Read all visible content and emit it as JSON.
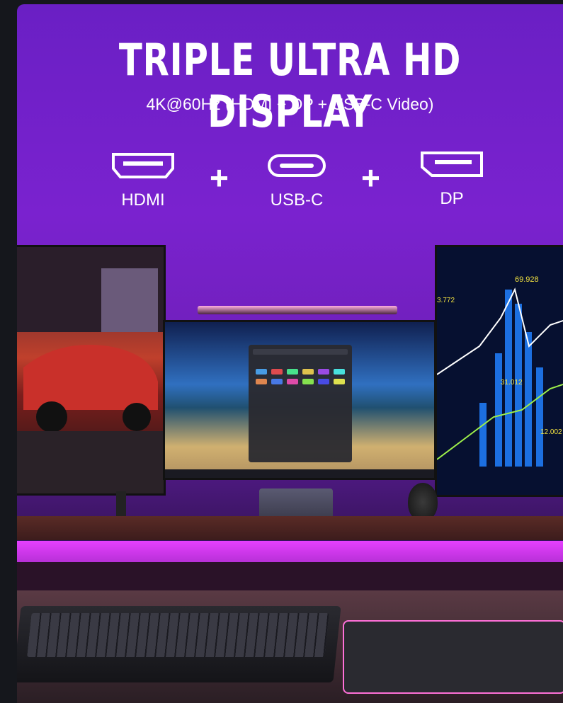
{
  "headline": {
    "title": "TRIPLE ULTRA HD DISPLAY",
    "subtitle": "4K@60Hz (HDMI + DP + USB-C Video)"
  },
  "ports": [
    {
      "label": "HDMI",
      "icon": "hdmi-port-icon"
    },
    {
      "label": "USB-C",
      "icon": "usb-c-port-icon"
    },
    {
      "label": "DP",
      "icon": "displayport-icon"
    }
  ],
  "separators": [
    "+",
    "+"
  ],
  "chart_readouts": {
    "peak": "69.928",
    "mid": "31.012",
    "low": "12.002",
    "left": "3.772"
  },
  "colors": {
    "background": "#7a22cf",
    "led": "#e640ff",
    "text": "#ffffff"
  }
}
